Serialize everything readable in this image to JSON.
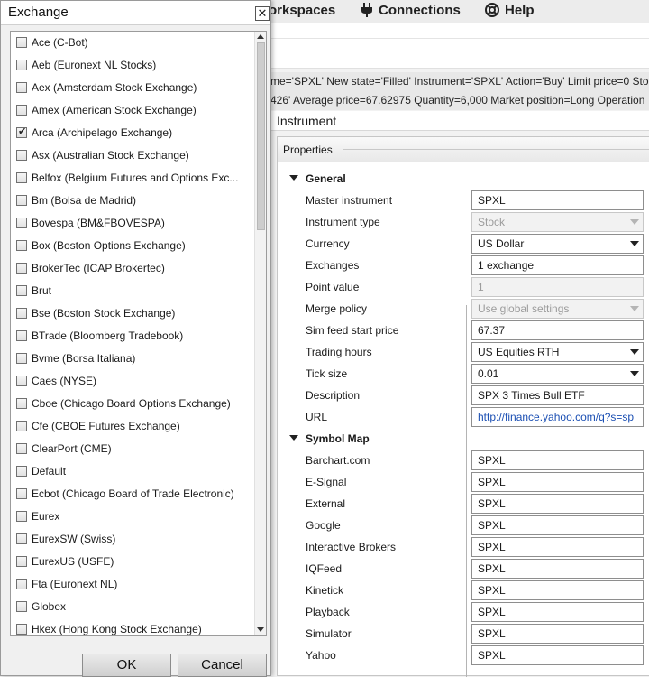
{
  "menubar": {
    "workspaces_label": "orkspaces",
    "connections_label": "Connections",
    "help_label": "Help"
  },
  "log": {
    "line1": "me='SPXL' New state='Filled' Instrument='SPXL' Action='Buy' Limit price=0 Sto",
    "line2": "426' Average price=67.62975 Quantity=6,000 Market position=Long Operation"
  },
  "instrument_header": "Instrument",
  "properties": {
    "title": "Properties",
    "general_label": "General",
    "general_rows": [
      {
        "label": "Master instrument",
        "value": "SPXL",
        "kind": "text"
      },
      {
        "label": "Instrument type",
        "value": "Stock",
        "kind": "select-disabled"
      },
      {
        "label": "Currency",
        "value": "US Dollar",
        "kind": "select"
      },
      {
        "label": "Exchanges",
        "value": "1 exchange",
        "kind": "text"
      },
      {
        "label": "Point value",
        "value": "1",
        "kind": "disabled"
      },
      {
        "label": "Merge policy",
        "value": "Use global settings",
        "kind": "select-disabled"
      },
      {
        "label": "Sim feed start price",
        "value": "67.37",
        "kind": "text"
      },
      {
        "label": "Trading hours",
        "value": "US Equities RTH",
        "kind": "select"
      },
      {
        "label": "Tick size",
        "value": "0.01",
        "kind": "select"
      },
      {
        "label": "Description",
        "value": "SPX 3 Times Bull ETF",
        "kind": "text"
      },
      {
        "label": "URL",
        "value": "http://finance.yahoo.com/q?s=sp",
        "kind": "link"
      }
    ],
    "symbol_map_label": "Symbol Map",
    "symbol_rows": [
      {
        "label": "Barchart.com",
        "value": "SPXL"
      },
      {
        "label": "E-Signal",
        "value": "SPXL"
      },
      {
        "label": "External",
        "value": "SPXL"
      },
      {
        "label": "Google",
        "value": "SPXL"
      },
      {
        "label": "Interactive Brokers",
        "value": "SPXL"
      },
      {
        "label": "IQFeed",
        "value": "SPXL"
      },
      {
        "label": "Kinetick",
        "value": "SPXL"
      },
      {
        "label": "Playback",
        "value": "SPXL"
      },
      {
        "label": "Simulator",
        "value": "SPXL"
      },
      {
        "label": "Yahoo",
        "value": "SPXL"
      }
    ]
  },
  "dialog": {
    "title": "Exchange",
    "close_glyph": "✕",
    "ok_label": "OK",
    "cancel_label": "Cancel",
    "exchanges": [
      {
        "label": "Ace (C-Bot)",
        "checked": false
      },
      {
        "label": "Aeb (Euronext NL Stocks)",
        "checked": false
      },
      {
        "label": "Aex (Amsterdam Stock Exchange)",
        "checked": false
      },
      {
        "label": "Amex (American Stock Exchange)",
        "checked": false
      },
      {
        "label": "Arca (Archipelago Exchange)",
        "checked": true
      },
      {
        "label": "Asx (Australian Stock Exchange)",
        "checked": false
      },
      {
        "label": "Belfox (Belgium Futures and Options Exc...",
        "checked": false
      },
      {
        "label": "Bm (Bolsa de Madrid)",
        "checked": false
      },
      {
        "label": "Bovespa (BM&FBOVESPA)",
        "checked": false
      },
      {
        "label": "Box (Boston Options Exchange)",
        "checked": false
      },
      {
        "label": "BrokerTec (ICAP Brokertec)",
        "checked": false
      },
      {
        "label": "Brut",
        "checked": false
      },
      {
        "label": "Bse (Boston Stock Exchange)",
        "checked": false
      },
      {
        "label": "BTrade (Bloomberg Tradebook)",
        "checked": false
      },
      {
        "label": "Bvme (Borsa Italiana)",
        "checked": false
      },
      {
        "label": "Caes (NYSE)",
        "checked": false
      },
      {
        "label": "Cboe (Chicago Board Options Exchange)",
        "checked": false
      },
      {
        "label": "Cfe (CBOE Futures Exchange)",
        "checked": false
      },
      {
        "label": "ClearPort (CME)",
        "checked": false
      },
      {
        "label": "Default",
        "checked": false
      },
      {
        "label": "Ecbot (Chicago Board of Trade Electronic)",
        "checked": false
      },
      {
        "label": "Eurex",
        "checked": false
      },
      {
        "label": "EurexSW (Swiss)",
        "checked": false
      },
      {
        "label": "EurexUS (USFE)",
        "checked": false
      },
      {
        "label": "Fta (Euronext NL)",
        "checked": false
      },
      {
        "label": "Globex",
        "checked": false
      },
      {
        "label": "Hkex (Hong Kong Stock Exchange)",
        "checked": false
      }
    ]
  }
}
